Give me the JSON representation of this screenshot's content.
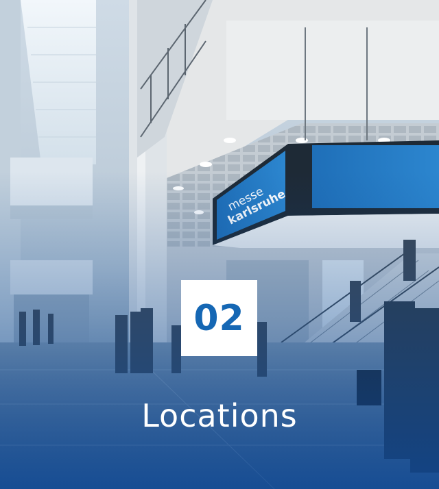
{
  "card": {
    "number": "02",
    "title": "Locations",
    "sign_line1": "messe",
    "sign_line2": "karlsruhe"
  },
  "colors": {
    "accent_blue": "#1567b4",
    "overlay_blue": "#0f4b96",
    "text_white": "#ffffff"
  }
}
